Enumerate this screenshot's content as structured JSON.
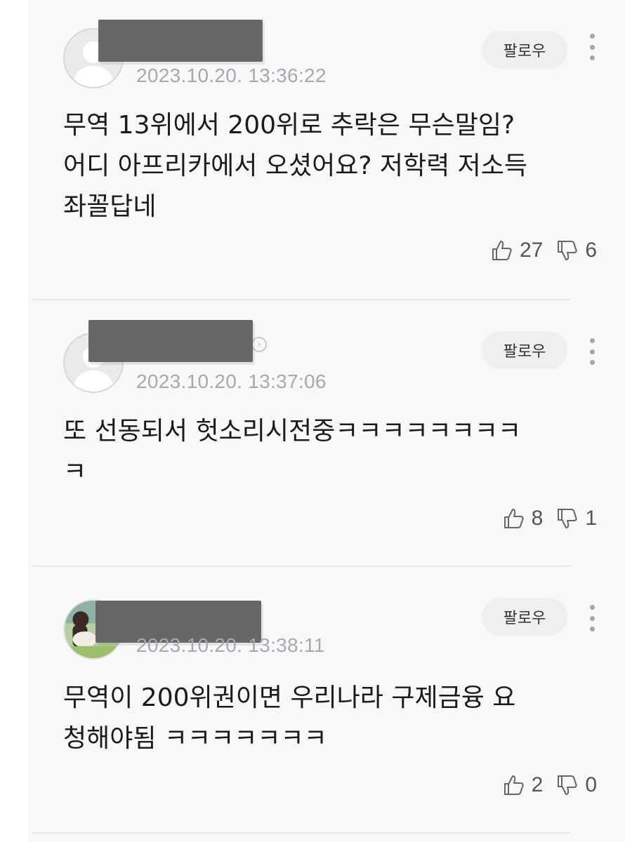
{
  "follow_label": "팔로우",
  "comments": [
    {
      "timestamp": "2023.10.20. 13:36:22",
      "body": "무역 13위에서 200위로 추락은 무슨말임?\n어디 아프리카에서 오셨어요? 저학력 저소득\n좌꼴답네",
      "likes": "27",
      "dislikes": "6",
      "avatar": "default-user-icon"
    },
    {
      "timestamp": "2023.10.20. 13:37:06",
      "body": "또 선동되서 헛소리시전중ㅋㅋㅋㅋㅋㅋㅋㅋ\nㅋ",
      "likes": "8",
      "dislikes": "1",
      "avatar": "default-user-icon"
    },
    {
      "timestamp": "2023.10.20. 13:38:11",
      "body": "무역이 200위권이면 우리나라 구제금융 요\n청해야됨 ㅋㅋㅋㅋㅋㅋㅋ",
      "likes": "2",
      "dislikes": "0",
      "avatar": "photo-avatar"
    }
  ],
  "colors": {
    "background": "#f8f8fa",
    "redaction": "#676769",
    "timestamp": "#a9a9ad",
    "text": "#1b1b1b"
  }
}
